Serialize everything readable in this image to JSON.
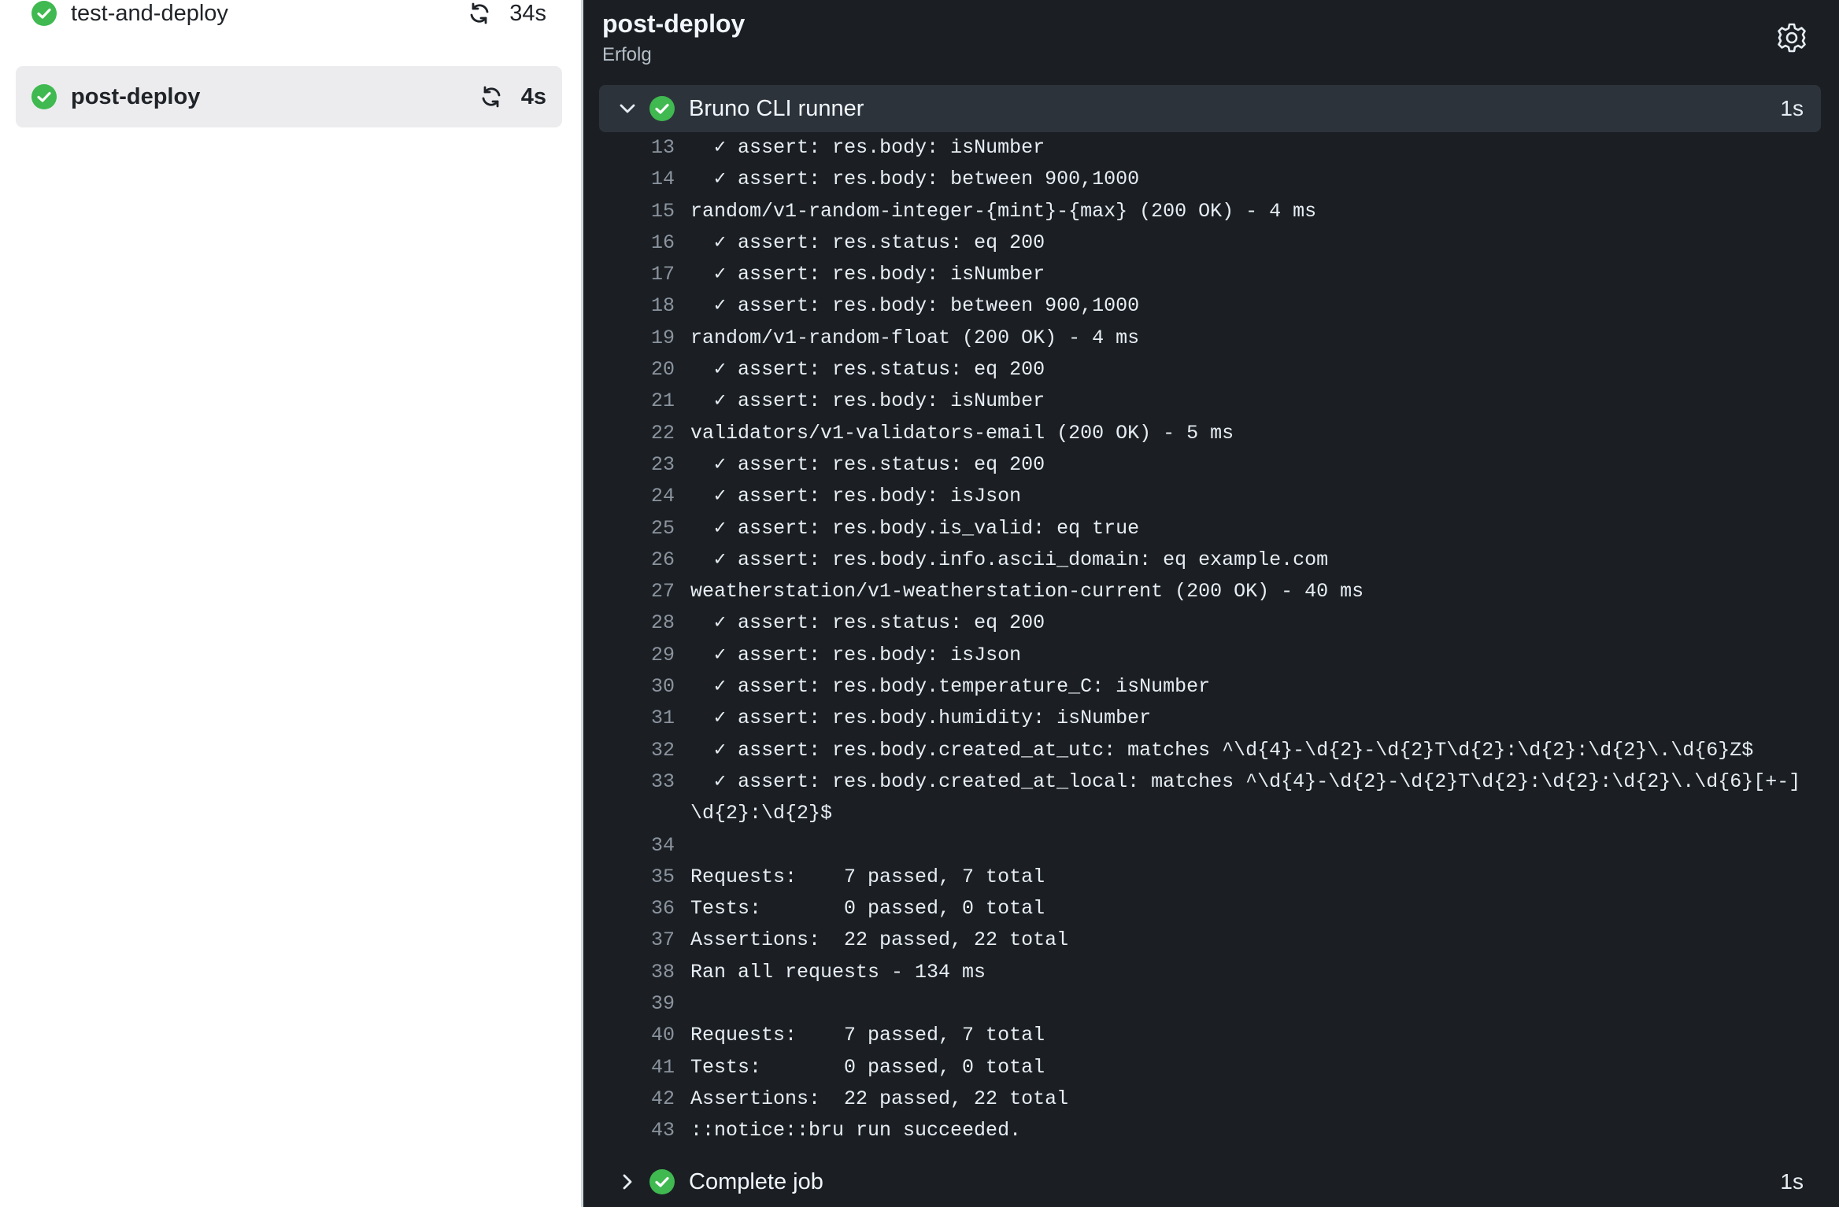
{
  "sidebar": {
    "jobs": [
      {
        "name": "test-and-deploy",
        "duration": "34s",
        "active": false
      },
      {
        "name": "post-deploy",
        "duration": "4s",
        "active": true
      }
    ]
  },
  "header": {
    "title": "post-deploy",
    "status": "Erfolg"
  },
  "steps": [
    {
      "label": "Bruno CLI runner",
      "time": "1s",
      "expanded": true
    },
    {
      "label": "Complete job",
      "time": "1s",
      "expanded": false
    }
  ],
  "log": [
    {
      "n": "13",
      "t": "  ✓ assert: res.body: isNumber"
    },
    {
      "n": "14",
      "t": "  ✓ assert: res.body: between 900,1000"
    },
    {
      "n": "15",
      "t": "random/v1-random-integer-{mint}-{max} (200 OK) - 4 ms"
    },
    {
      "n": "16",
      "t": "  ✓ assert: res.status: eq 200"
    },
    {
      "n": "17",
      "t": "  ✓ assert: res.body: isNumber"
    },
    {
      "n": "18",
      "t": "  ✓ assert: res.body: between 900,1000"
    },
    {
      "n": "19",
      "t": "random/v1-random-float (200 OK) - 4 ms"
    },
    {
      "n": "20",
      "t": "  ✓ assert: res.status: eq 200"
    },
    {
      "n": "21",
      "t": "  ✓ assert: res.body: isNumber"
    },
    {
      "n": "22",
      "t": "validators/v1-validators-email (200 OK) - 5 ms"
    },
    {
      "n": "23",
      "t": "  ✓ assert: res.status: eq 200"
    },
    {
      "n": "24",
      "t": "  ✓ assert: res.body: isJson"
    },
    {
      "n": "25",
      "t": "  ✓ assert: res.body.is_valid: eq true"
    },
    {
      "n": "26",
      "t": "  ✓ assert: res.body.info.ascii_domain: eq example.com"
    },
    {
      "n": "27",
      "t": "weatherstation/v1-weatherstation-current (200 OK) - 40 ms"
    },
    {
      "n": "28",
      "t": "  ✓ assert: res.status: eq 200"
    },
    {
      "n": "29",
      "t": "  ✓ assert: res.body: isJson"
    },
    {
      "n": "30",
      "t": "  ✓ assert: res.body.temperature_C: isNumber"
    },
    {
      "n": "31",
      "t": "  ✓ assert: res.body.humidity: isNumber"
    },
    {
      "n": "32",
      "t": "  ✓ assert: res.body.created_at_utc: matches ^\\d{4}-\\d{2}-\\d{2}T\\d{2}:\\d{2}:\\d{2}\\.\\d{6}Z$"
    },
    {
      "n": "33",
      "t": "  ✓ assert: res.body.created_at_local: matches ^\\d{4}-\\d{2}-\\d{2}T\\d{2}:\\d{2}:\\d{2}\\.\\d{6}[+-]\\d{2}:\\d{2}$"
    },
    {
      "n": "34",
      "t": ""
    },
    {
      "n": "35",
      "t": "Requests:    7 passed, 7 total"
    },
    {
      "n": "36",
      "t": "Tests:       0 passed, 0 total"
    },
    {
      "n": "37",
      "t": "Assertions:  22 passed, 22 total"
    },
    {
      "n": "38",
      "t": "Ran all requests - 134 ms"
    },
    {
      "n": "39",
      "t": ""
    },
    {
      "n": "40",
      "t": "Requests:    7 passed, 7 total"
    },
    {
      "n": "41",
      "t": "Tests:       0 passed, 0 total"
    },
    {
      "n": "42",
      "t": "Assertions:  22 passed, 22 total"
    },
    {
      "n": "43",
      "t": "::notice::bru run succeeded."
    }
  ],
  "icons": {
    "success": "check-circle-icon",
    "rerun": "sync-icon",
    "settings": "gear-icon",
    "expand": "chevron-down-icon",
    "collapse": "chevron-right-icon"
  },
  "colors": {
    "success": "#3fb950",
    "log_bg": "#1b1f24",
    "step_header_bg": "#2d333b"
  }
}
